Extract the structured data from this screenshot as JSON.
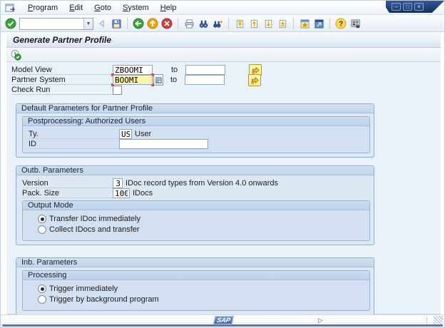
{
  "menubar": {
    "items": [
      "Program",
      "Edit",
      "Goto",
      "System",
      "Help"
    ]
  },
  "window_controls": {
    "minimize": "–",
    "maximize": "□",
    "close": "×"
  },
  "toolbar": {
    "command_value": "",
    "icons": [
      "enter",
      "command-field",
      "collapse-command",
      "save",
      "back",
      "exit",
      "cancel",
      "print",
      "find",
      "find-next",
      "first-page",
      "previous-page",
      "next-page",
      "last-page",
      "new-session",
      "create-shortcut",
      "help",
      "customize-layout"
    ]
  },
  "title_bar": {
    "title": "Generate Partner Profile"
  },
  "app_toolbar": {
    "icons": [
      "execute"
    ]
  },
  "selection": {
    "model_view": {
      "label": "Model View",
      "value": "ZBOOMI",
      "to_label": "to",
      "to_value": ""
    },
    "partner_system": {
      "label": "Partner System",
      "value": "BOOMI",
      "to_label": "to",
      "to_value": ""
    },
    "check_run": {
      "label": "Check Run",
      "checked": false
    }
  },
  "sections": {
    "default_params": {
      "title": "Default Parameters for Partner Profile",
      "postprocessing": {
        "title": "Postprocessing: Authorized Users",
        "ty": {
          "label": "Ty.",
          "value": "US",
          "desc": "User"
        },
        "id": {
          "label": "ID",
          "value": ""
        }
      }
    },
    "outb": {
      "title": "Outb. Parameters",
      "version": {
        "label": "Version",
        "value": "3",
        "desc": "IDoc record types from Version 4.0 onwards"
      },
      "pack_size": {
        "label": "Pack. Size",
        "value": "100",
        "desc": "IDocs"
      },
      "output_mode": {
        "title": "Output Mode",
        "options": [
          {
            "label": "Transfer IDoc immediately",
            "selected": true
          },
          {
            "label": "Collect IDocs and transfer",
            "selected": false
          }
        ]
      }
    },
    "inb": {
      "title": "Inb. Parameters",
      "processing": {
        "title": "Processing",
        "options": [
          {
            "label": "Trigger immediately",
            "selected": true
          },
          {
            "label": "Trigger by background program",
            "selected": false
          }
        ]
      }
    }
  },
  "statusbar": {
    "sap_logo": "SAP",
    "expand_icon": "▷"
  },
  "colors": {
    "client_bg": "#e9f1f9",
    "group_bg": "#dde8f5",
    "group_header_bg": "#c9daee",
    "focus_field_bg": "#fdf5ae",
    "focus_corner": "#e0443a",
    "accent_blue": "#4a72b8",
    "multiselect_yellow": "#ffe98c"
  }
}
